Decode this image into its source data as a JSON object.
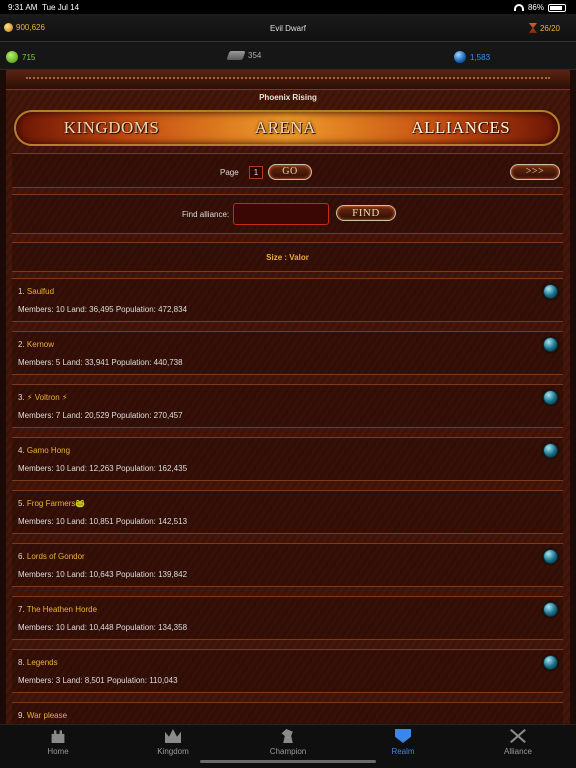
{
  "status": {
    "time": "9:31 AM",
    "date": "Tue Jul 14",
    "battery": "86%",
    "battery_level": 0.86
  },
  "top": {
    "gold": "900,626",
    "title": "Evil Dwarf",
    "turns": "26/20"
  },
  "resources": {
    "food": "715",
    "stone": "354",
    "mana": "1,583"
  },
  "realm_name": "Phoenix Rising",
  "tabs": [
    {
      "label": "KINGDOMS",
      "active": false
    },
    {
      "label": "ARENA",
      "active": false
    },
    {
      "label": "ALLIANCES",
      "active": true
    }
  ],
  "pager": {
    "label": "Page",
    "page": "1",
    "go_label": "GO",
    "next_label": ">>>"
  },
  "search": {
    "label": "Find alliance:",
    "value": "",
    "placeholder": "",
    "find_label": "FIND"
  },
  "sort": {
    "text": "Size   :   Valor"
  },
  "alliances": [
    {
      "rank": "1.",
      "name": "Saulfud",
      "stats": "Members: 10 Land: 36,495 Population: 472,834",
      "gem": true
    },
    {
      "rank": "2.",
      "name": "Kernow",
      "stats": "Members: 5 Land: 33,941 Population: 440,738",
      "gem": true
    },
    {
      "rank": "3.",
      "name": "⚡ Voltron ⚡",
      "stats": "Members: 7 Land: 20,529 Population: 270,457",
      "gem": true
    },
    {
      "rank": "4.",
      "name": "Gamo Hong",
      "stats": "Members: 10 Land: 12,263 Population: 162,435",
      "gem": true
    },
    {
      "rank": "5.",
      "name": "Frog Farmers🐸",
      "stats": "Members: 10 Land: 10,851 Population: 142,513",
      "gem": false
    },
    {
      "rank": "6.",
      "name": "Lords of Gondor",
      "stats": "Members: 10 Land: 10,643 Population: 139,842",
      "gem": true
    },
    {
      "rank": "7.",
      "name": "The Heathen Horde",
      "stats": "Members: 10 Land: 10,448 Population: 134,358",
      "gem": true
    },
    {
      "rank": "8.",
      "name": "Legends",
      "stats": "Members: 3 Land: 8,501 Population: 110,043",
      "gem": true
    },
    {
      "rank": "9.",
      "name": "War please",
      "stats": "",
      "gem": false
    }
  ],
  "tabbar": [
    {
      "label": "Home",
      "icon": "castle-icon"
    },
    {
      "label": "Kingdom",
      "icon": "crown-icon"
    },
    {
      "label": "Champion",
      "icon": "horse-icon"
    },
    {
      "label": "Realm",
      "icon": "shield-icon",
      "active": true
    },
    {
      "label": "Alliance",
      "icon": "crossed-swords-icon"
    }
  ],
  "colors": {
    "accent_gold": "#e9b23a",
    "active_tab": "#3b86e6",
    "background": "#3b1208"
  }
}
